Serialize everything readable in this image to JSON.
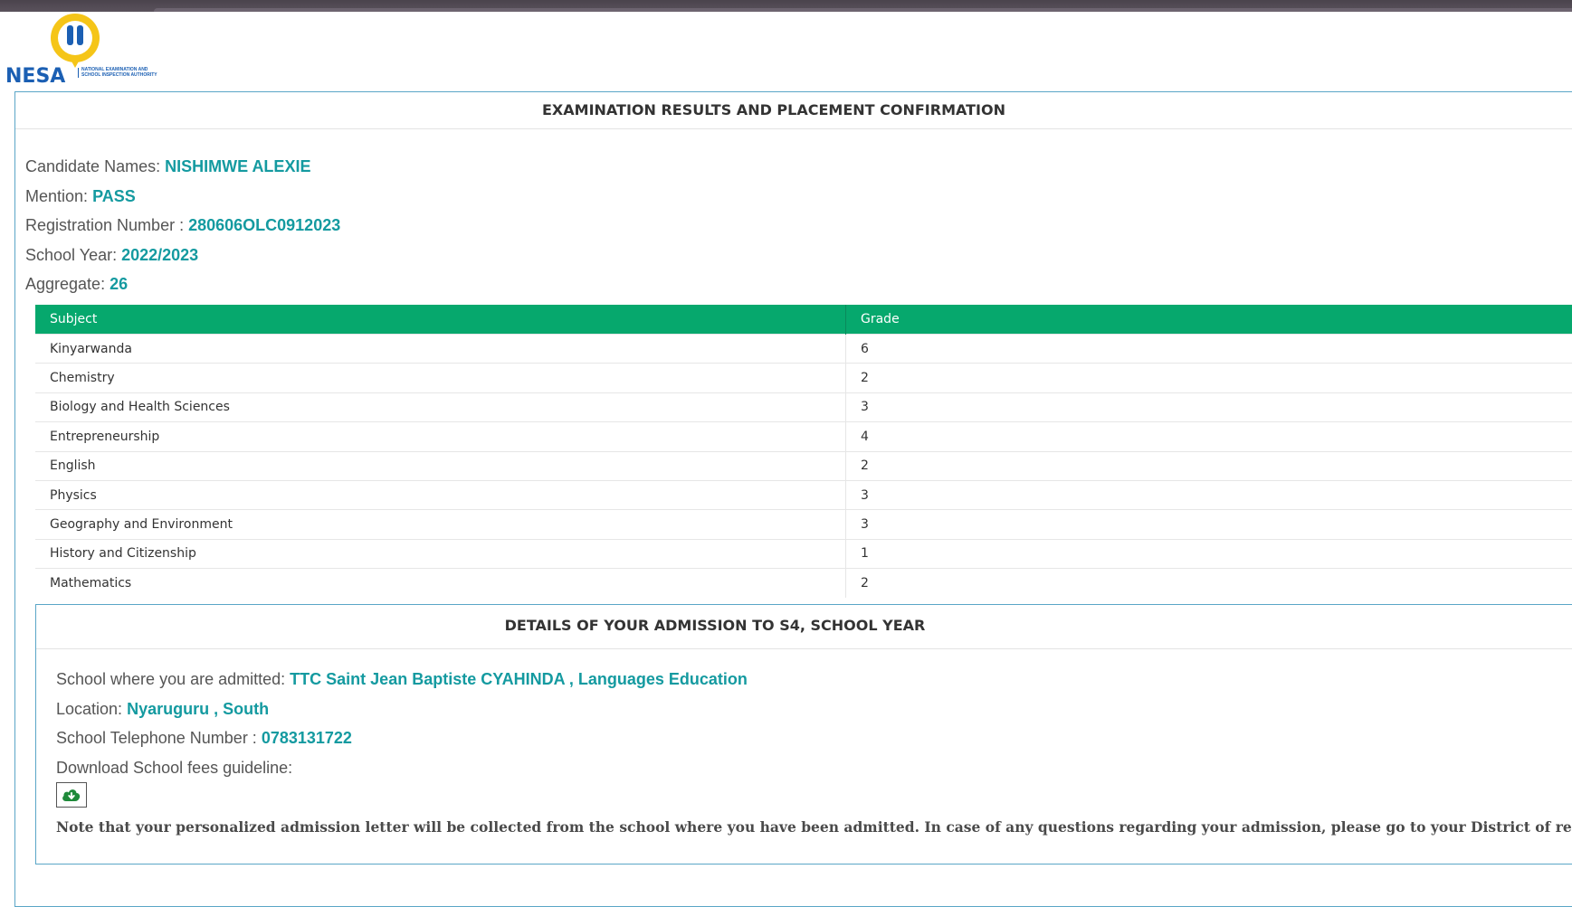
{
  "brand": {
    "name": "NESA",
    "tagline": "National Examination and School Inspection Authority",
    "colors": {
      "blue": "#1b5fb3",
      "yellow": "#f5c518"
    }
  },
  "results_panel": {
    "title": "EXAMINATION RESULTS AND PLACEMENT CONFIRMATION",
    "candidate": {
      "names_label": "Candidate Names:",
      "names": "NISHIMWE ALEXIE",
      "mention_label": "Mention:",
      "mention": "PASS",
      "registration_label": "Registration Number :",
      "registration": "280606OLC0912023",
      "school_year_label": "School Year:",
      "school_year": "2022/2023",
      "aggregate_label": "Aggregate:",
      "aggregate": "26"
    },
    "table": {
      "headers": {
        "subject": "Subject",
        "grade": "Grade"
      },
      "rows": [
        {
          "subject": "Kinyarwanda",
          "grade": "6"
        },
        {
          "subject": "Chemistry",
          "grade": "2"
        },
        {
          "subject": "Biology and Health Sciences",
          "grade": "3"
        },
        {
          "subject": "Entrepreneurship",
          "grade": "4"
        },
        {
          "subject": "English",
          "grade": "2"
        },
        {
          "subject": "Physics",
          "grade": "3"
        },
        {
          "subject": "Geography and Environment",
          "grade": "3"
        },
        {
          "subject": "History and Citizenship",
          "grade": "1"
        },
        {
          "subject": "Mathematics",
          "grade": "2"
        }
      ]
    }
  },
  "admission_panel": {
    "title": "DETAILS OF YOUR ADMISSION TO S4, SCHOOL YEAR",
    "school_label": "School where you are admitted:",
    "school": "TTC Saint Jean Baptiste CYAHINDA , Languages Education",
    "location_label": "Location:",
    "location": "Nyaruguru , South",
    "phone_label": "School Telephone Number :",
    "phone": "0783131722",
    "download_label": "Download School fees guideline:",
    "download_icon": "cloud-download-icon",
    "note": "Note that your personalized admission letter will be collected from the school where you have been admitted. In case of any questions regarding your admission, please go to your District of residence."
  },
  "theme": {
    "accent": "#149aa0",
    "table_header": "#06a86d",
    "border": "#5aa6c7"
  }
}
